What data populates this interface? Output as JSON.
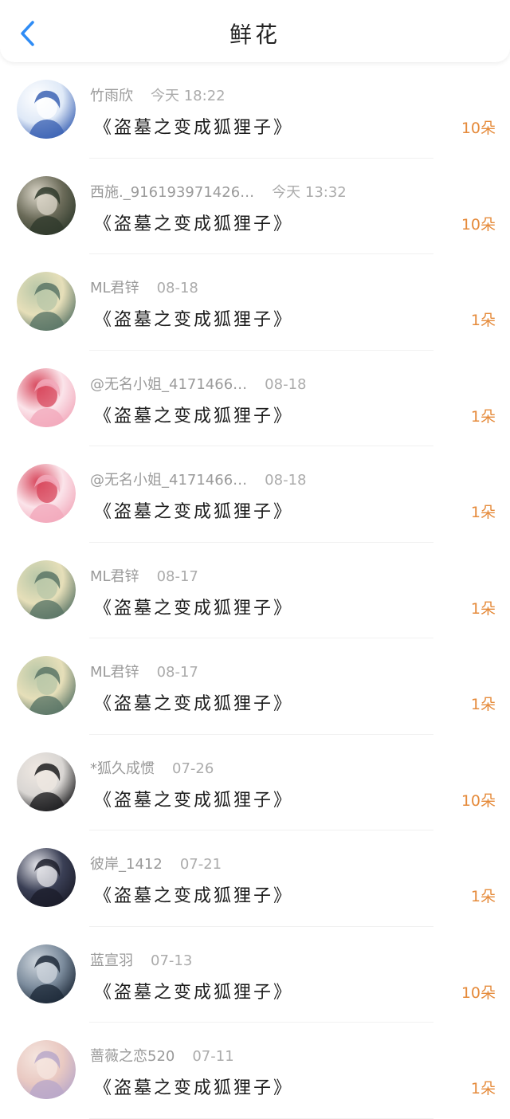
{
  "header": {
    "title": "鲜花",
    "back_icon": "chevron-left-icon",
    "accent": "#2f8cf5"
  },
  "colors": {
    "count": "#e58a3a",
    "meta": "#9a9a9a",
    "book": "#1d1d1d"
  },
  "items": [
    {
      "name": "竹雨欣",
      "time": "今天 18:22",
      "book": "《盗墓之变成狐狸子》",
      "count": "10朵",
      "avatar": {
        "c1": "#dfe9f7",
        "c2": "#3c63b4",
        "c3": "#ffffff"
      }
    },
    {
      "name": "西施._916193971426…",
      "time": "今天 13:32",
      "book": "《盗墓之变成狐狸子》",
      "count": "10朵",
      "avatar": {
        "c1": "#6a6a58",
        "c2": "#2f3a2c",
        "c3": "#dbd6c8"
      }
    },
    {
      "name": "ML君锌",
      "time": "08-18",
      "book": "《盗墓之变成狐狸子》",
      "count": "1朵",
      "avatar": {
        "c1": "#e6dfb9",
        "c2": "#5a7566",
        "c3": "#b8c7a8"
      }
    },
    {
      "name": "@无名小姐_4171466…",
      "time": "08-18",
      "book": "《盗墓之变成狐狸子》",
      "count": "1朵",
      "avatar": {
        "c1": "#fbe4ea",
        "c2": "#f2a9bb",
        "c3": "#d8475c"
      }
    },
    {
      "name": "@无名小姐_4171466…",
      "time": "08-18",
      "book": "《盗墓之变成狐狸子》",
      "count": "1朵",
      "avatar": {
        "c1": "#fbe4ea",
        "c2": "#f2a9bb",
        "c3": "#d8475c"
      }
    },
    {
      "name": "ML君锌",
      "time": "08-17",
      "book": "《盗墓之变成狐狸子》",
      "count": "1朵",
      "avatar": {
        "c1": "#e6dfb9",
        "c2": "#5a7566",
        "c3": "#b8c7a8"
      }
    },
    {
      "name": "ML君锌",
      "time": "08-17",
      "book": "《盗墓之变成狐狸子》",
      "count": "1朵",
      "avatar": {
        "c1": "#e6dfb9",
        "c2": "#5a7566",
        "c3": "#b8c7a8"
      }
    },
    {
      "name": "*狐久成惯",
      "time": "07-26",
      "book": "《盗墓之变成狐狸子》",
      "count": "10朵",
      "avatar": {
        "c1": "#d9d6d3",
        "c2": "#1d1d1f",
        "c3": "#efe8e2"
      }
    },
    {
      "name": "彼岸_1412",
      "time": "07-21",
      "book": "《盗墓之变成狐狸子》",
      "count": "1朵",
      "avatar": {
        "c1": "#3a3f55",
        "c2": "#1c1d2a",
        "c3": "#e5e5ea"
      }
    },
    {
      "name": "蓝宣羽",
      "time": "07-13",
      "book": "《盗墓之变成狐狸子》",
      "count": "10朵",
      "avatar": {
        "c1": "#7b8b9c",
        "c2": "#1e2a39",
        "c3": "#cfd6dd"
      }
    },
    {
      "name": "蔷薇之恋520",
      "time": "07-11",
      "book": "《盗墓之变成狐狸子》",
      "count": "1朵",
      "avatar": {
        "c1": "#e9c9c2",
        "c2": "#b9a8c9",
        "c3": "#f5e6df"
      }
    }
  ]
}
